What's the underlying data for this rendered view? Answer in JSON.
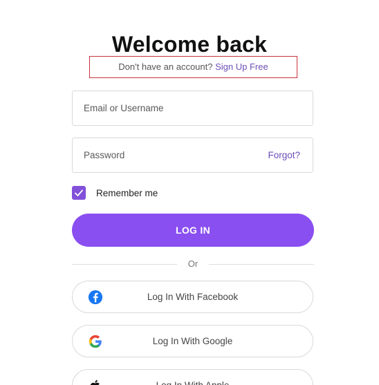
{
  "header": {
    "title": "Welcome back",
    "signup_prompt": "Don't have an account?",
    "signup_link": "Sign Up Free"
  },
  "form": {
    "username": {
      "placeholder": "Email or Username",
      "value": ""
    },
    "password": {
      "placeholder": "Password",
      "value": "",
      "forgot_label": "Forgot?"
    },
    "remember": {
      "label": "Remember me",
      "checked": true
    },
    "login_label": "LOG IN",
    "divider_label": "Or"
  },
  "social": {
    "facebook_label": "Log In With Facebook",
    "google_label": "Log In With Google",
    "apple_label": "Log In With Apple"
  },
  "colors": {
    "accent": "#8a4ff0",
    "link": "#6b4fb8",
    "highlight_border": "#c8323a",
    "facebook": "#1877f2"
  }
}
